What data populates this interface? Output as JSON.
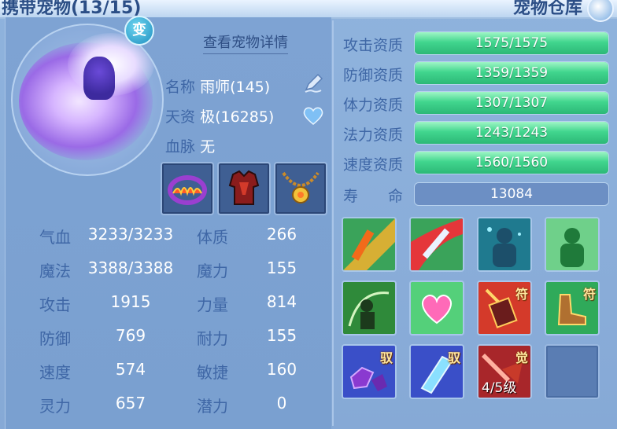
{
  "header": {
    "left_title": "携带宠物(13/15)",
    "right_title": "宠物仓库"
  },
  "pet": {
    "transform_badge": "变",
    "view_details": "查看宠物详情",
    "name_label": "名称",
    "name_value": "雨师(145)",
    "aptitude_label": "天资",
    "aptitude_value": "极(16285)",
    "bloodline_label": "血脉",
    "bloodline_value": "无"
  },
  "equipment": [
    {
      "name": "flame-collar"
    },
    {
      "name": "red-armor"
    },
    {
      "name": "gold-pendant"
    }
  ],
  "stats_left": [
    {
      "label": "气血",
      "value": "3233/3233"
    },
    {
      "label": "魔法",
      "value": "3388/3388"
    },
    {
      "label": "攻击",
      "value": "1915"
    },
    {
      "label": "防御",
      "value": "769"
    },
    {
      "label": "速度",
      "value": "574"
    },
    {
      "label": "灵力",
      "value": "657"
    }
  ],
  "stats_right": [
    {
      "label": "体质",
      "value": "266"
    },
    {
      "label": "魔力",
      "value": "155"
    },
    {
      "label": "力量",
      "value": "814"
    },
    {
      "label": "耐力",
      "value": "155"
    },
    {
      "label": "敏捷",
      "value": "160"
    },
    {
      "label": "潜力",
      "value": "0"
    }
  ],
  "attributes": [
    {
      "label": "攻击资质",
      "text": "1575/1575",
      "fill": 1.0
    },
    {
      "label": "防御资质",
      "text": "1359/1359",
      "fill": 1.0
    },
    {
      "label": "体力资质",
      "text": "1307/1307",
      "fill": 1.0
    },
    {
      "label": "法力资质",
      "text": "1243/1243",
      "fill": 1.0
    },
    {
      "label": "速度资质",
      "text": "1560/1560",
      "fill": 1.0
    }
  ],
  "lifespan": {
    "label": "寿　　命",
    "value": "13084"
  },
  "skills": [
    {
      "name": "fire-sword-skill",
      "tag": ""
    },
    {
      "name": "sword-slash-skill",
      "tag": ""
    },
    {
      "name": "spirit-figure-skill",
      "tag": ""
    },
    {
      "name": "green-figure-skill",
      "tag": ""
    },
    {
      "name": "shield-warrior-skill",
      "tag": ""
    },
    {
      "name": "heart-skill",
      "tag": ""
    },
    {
      "name": "talisman-book-skill",
      "tag": "符"
    },
    {
      "name": "talisman-boot-skill",
      "tag": "符"
    },
    {
      "name": "purple-crystal-skill",
      "tag": "驭"
    },
    {
      "name": "ice-crystal-skill",
      "tag": "驭"
    },
    {
      "name": "awaken-skill",
      "tag": "觉",
      "level": "4/5级"
    },
    {
      "name": "empty-skill-slot",
      "tag": ""
    }
  ],
  "colors": {
    "label_blue": "#3f67a6",
    "bar_green": "#41d68e",
    "panel_bg": "#86a9d6"
  }
}
